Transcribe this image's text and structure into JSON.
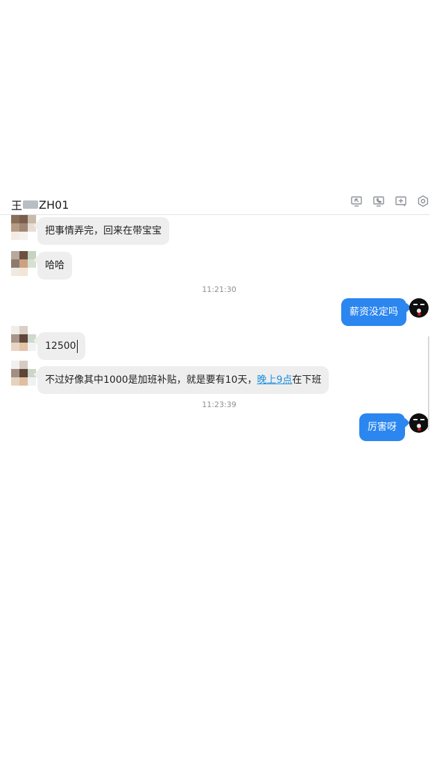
{
  "header": {
    "contact_name_prefix": "王",
    "contact_name_suffix": "ZH01",
    "toolbar_icons": [
      "screen-share-icon",
      "phone-call-icon",
      "add-member-icon",
      "settings-icon"
    ]
  },
  "messages": {
    "m1": "把事情弄完，回来在带宝宝",
    "m2": "哈哈",
    "t1": "11:21:30",
    "m3": "薪资没定吗",
    "m4": "12500",
    "m5_pre": "不过好像其中1000是加班补贴，就是要有10天，",
    "m5_link": "晚上9点",
    "m5_post": "在下班",
    "t2": "11:23:39",
    "m6": "厉害呀"
  },
  "colors": {
    "outgoing_bubble": "#2b86f0",
    "incoming_bubble": "#eeeeee",
    "link": "#1a8ee0",
    "timestamp": "#8e8e8e"
  }
}
